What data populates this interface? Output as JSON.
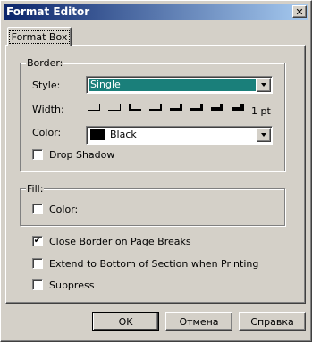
{
  "window": {
    "title": "Format Editor",
    "close_symbol": "✕"
  },
  "tab": {
    "label": "Format Box"
  },
  "border_group": {
    "legend": "Border:",
    "style_label": "Style:",
    "style_value": "Single",
    "width_label": "Width:",
    "width_value": "1 pt",
    "width_options_count": 8,
    "color_label": "Color:",
    "color_value": "Black",
    "color_swatch": "#000000",
    "drop_shadow_label": "Drop Shadow",
    "drop_shadow_checked": false
  },
  "fill_group": {
    "legend": "Fill:",
    "color_label": "Color:",
    "color_checked": false
  },
  "options": {
    "close_border_label": "Close Border on Page Breaks",
    "close_border_checked": true,
    "close_border_mark": "✔",
    "extend_label": "Extend to Bottom of Section when Printing",
    "extend_checked": false,
    "suppress_label": "Suppress",
    "suppress_checked": false
  },
  "buttons": {
    "ok": "OK",
    "cancel": "Отмена",
    "help": "Справка"
  },
  "colors": {
    "titlebar_start": "#0a246a",
    "titlebar_end": "#a6caf0",
    "selection": "#1a7f7a",
    "face": "#d4d0c8"
  }
}
